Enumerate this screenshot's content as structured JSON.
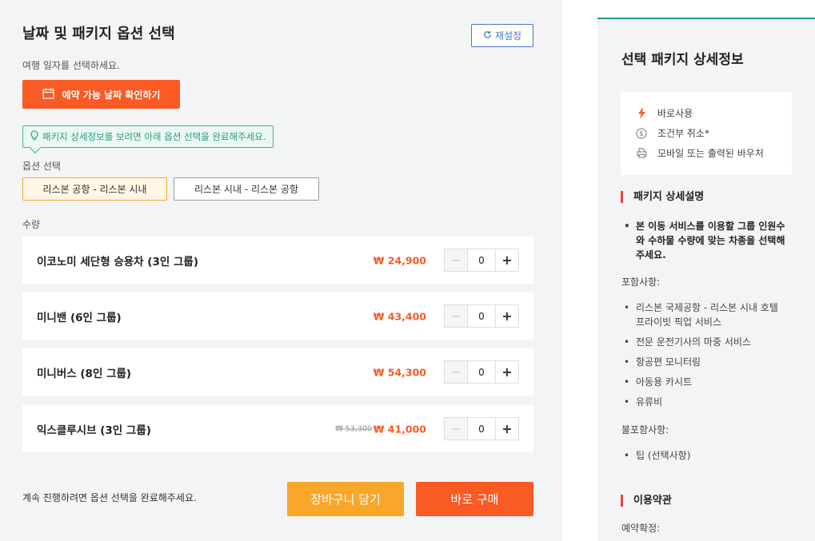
{
  "options": {
    "title": "날짜 및 패키지 옵션 선택",
    "reset_label": "재설정",
    "date_hint": "여행 일자를 선택하세요.",
    "date_button_label": "예약 가능 날짜 확인하기",
    "info_tip": "패키지 상세정보를 보려면 아래 옵션 선택을 완료해주세요.",
    "option_label": "옵션 선택",
    "option_choices": [
      {
        "label": "리스본 공항 - 리스본 시내",
        "selected": true
      },
      {
        "label": "리스본 시내 - 리스본 공항",
        "selected": false
      }
    ],
    "quantity_label": "수량",
    "items": [
      {
        "name": "이코노미 세단형 승용차 (3인 그룹)",
        "price": "₩ 24,900",
        "original_price": "",
        "qty": "0"
      },
      {
        "name": "미니밴 (6인 그룹)",
        "price": "₩ 43,400",
        "original_price": "",
        "qty": "0"
      },
      {
        "name": "미니버스 (8인 그룹)",
        "price": "₩ 54,300",
        "original_price": "",
        "qty": "0"
      },
      {
        "name": "익스클루시브 (3인 그룹)",
        "price": "₩ 41,000",
        "original_price": "₩ 53,300",
        "qty": "0"
      }
    ],
    "bottom_hint": "계속 진행하려면 옵션 선택을 완료해주세요.",
    "cart_button_label": "장바구니 담기",
    "buy_button_label": "바로 구매",
    "minus_symbol": "−",
    "plus_symbol": "+"
  },
  "details": {
    "title": "선택 패키지 상세정보",
    "features": [
      {
        "icon": "lightning-icon",
        "label": "바로사용"
      },
      {
        "icon": "dollar-icon",
        "label": "조건부 취소*"
      },
      {
        "icon": "printer-icon",
        "label": "모바일 또는 출력된 바우처"
      }
    ],
    "description_heading": "패키지 상세설명",
    "description_bullets": [
      "본 이동 서비스를 이용할 그룹 인원수와 수하물 수량에 맞는 차종을 선택해 주세요."
    ],
    "included_label": "포함사항:",
    "included": [
      "리스본 국제공항 - 리스본 시내 호텔 프라이빗 픽업 서비스",
      "전문 운전기사의 마중 서비스",
      "항공편 모니터링",
      "아동용 카시트",
      "유류비"
    ],
    "excluded_label": "불포함사항:",
    "excluded": [
      "팁 (선택사항)"
    ],
    "terms_heading": "이용약관",
    "terms_sub": "예약확정:"
  },
  "colors": {
    "accent_orange": "#fa5a24",
    "cart_yellow": "#f8a72b",
    "teal": "#1e9c85",
    "reset_blue": "#4a76c8",
    "section_red": "#e84242"
  }
}
